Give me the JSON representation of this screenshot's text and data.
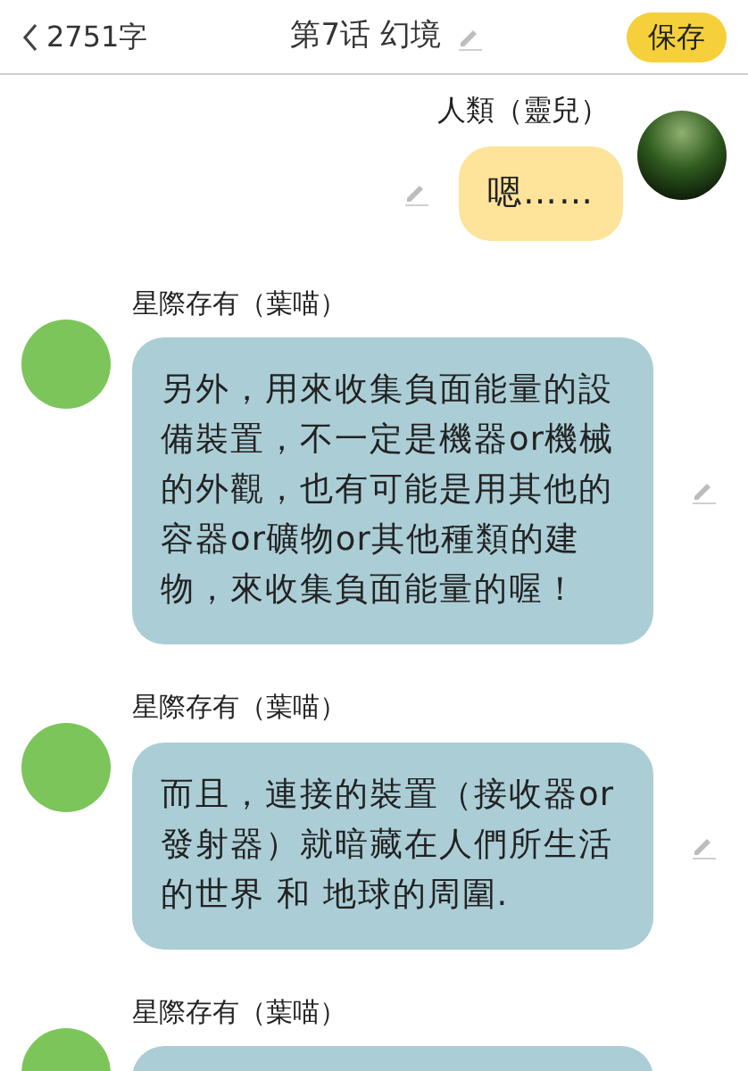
{
  "header": {
    "back_label": "2751字",
    "title": "第7话 幻境",
    "save_button": "保存"
  },
  "messages": [
    {
      "kind": "outgoing",
      "name": "人類（靈兒）",
      "text": "嗯……"
    },
    {
      "kind": "incoming",
      "name": "星際存有（葉喵）",
      "text": "另外，用來收集負面能量的設備裝置，不一定是機器or機械的外觀，也有可能是用其他的容器or礦物or其他種類的建物，來收集負面能量的喔！"
    },
    {
      "kind": "incoming",
      "name": "星際存有（葉喵）",
      "text": "而且，連接的裝置（接收器or發射器）就暗藏在人們所生活的世界 和 地球的周圍."
    },
    {
      "kind": "incoming",
      "name": "星際存有（葉喵）"
    }
  ]
}
